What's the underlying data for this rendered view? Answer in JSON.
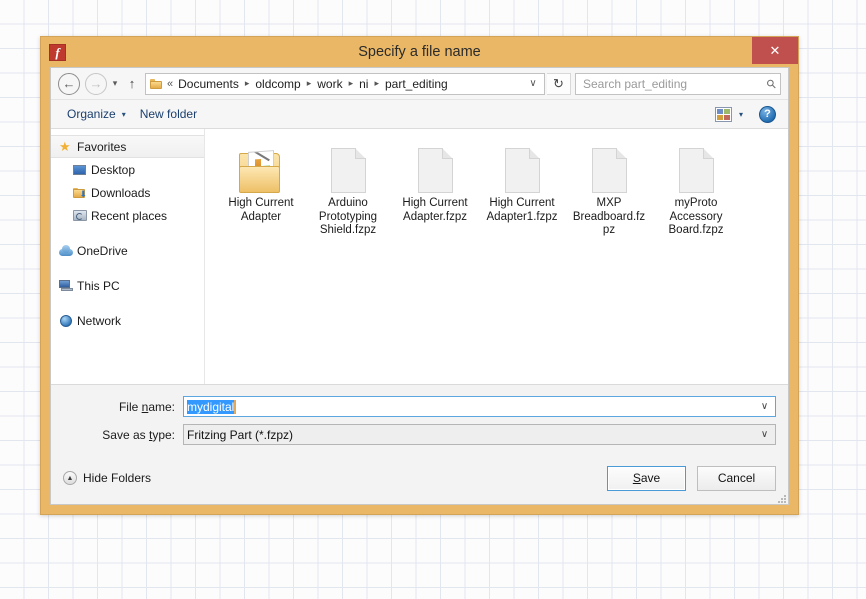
{
  "window": {
    "title": "Specify a file name",
    "app_icon": "fritzing-f-icon",
    "close_label": "✕",
    "frame_color": "#e9b765",
    "close_color": "#c0504d"
  },
  "nav": {
    "back_label": "←",
    "forward_label": "→",
    "recent_label": "▾",
    "up_label": "↑",
    "ellipsis": "«",
    "breadcrumbs": [
      "Documents",
      "oldcomp",
      "work",
      "ni",
      "part_editing"
    ],
    "separator": "▸",
    "dropdown_caret": "∨",
    "refresh_label": "↻"
  },
  "search": {
    "placeholder": "Search part_editing",
    "icon": "magnifier-icon"
  },
  "toolbar": {
    "organize_label": "Organize",
    "organize_caret": "▾",
    "new_folder_label": "New folder",
    "view_caret": "▾",
    "help_label": "?"
  },
  "sidebar": {
    "items": [
      {
        "label": "Favorites",
        "icon": "star-icon",
        "level": "group",
        "selected": true
      },
      {
        "label": "Desktop",
        "icon": "monitor-icon",
        "level": "child",
        "selected": false
      },
      {
        "label": "Downloads",
        "icon": "downloads-folder-icon",
        "level": "child",
        "selected": false
      },
      {
        "label": "Recent places",
        "icon": "recent-places-icon",
        "level": "child",
        "selected": false
      },
      {
        "label": "OneDrive",
        "icon": "cloud-icon",
        "level": "group",
        "selected": false
      },
      {
        "label": "This PC",
        "icon": "computer-icon",
        "level": "group",
        "selected": false
      },
      {
        "label": "Network",
        "icon": "network-globe-icon",
        "level": "group",
        "selected": false
      }
    ]
  },
  "files": [
    {
      "name": "High Current Adapter",
      "type": "folder"
    },
    {
      "name": "Arduino Prototyping Shield.fzpz",
      "type": "document"
    },
    {
      "name": "High Current Adapter.fzpz",
      "type": "document"
    },
    {
      "name": "High Current Adapter1.fzpz",
      "type": "document"
    },
    {
      "name": "MXP Breadboard.fzpz",
      "type": "document"
    },
    {
      "name": "myProto Accessory Board.fzpz",
      "type": "document"
    }
  ],
  "form": {
    "filename_label_pre": "File ",
    "filename_label_accel": "n",
    "filename_label_post": "ame:",
    "filename_value": "mydigital",
    "filename_selected": true,
    "savetype_label_pre": "Save as ",
    "savetype_label_accel": "t",
    "savetype_label_post": "ype:",
    "savetype_value": "Fritzing Part (*.fzpz)",
    "caret": "∨",
    "selection_color": "#3399ff"
  },
  "actions": {
    "hide_folders_label": "Hide Folders",
    "hide_folders_glyph": "▲",
    "save_pre": "",
    "save_accel": "S",
    "save_post": "ave",
    "cancel_label": "Cancel"
  }
}
